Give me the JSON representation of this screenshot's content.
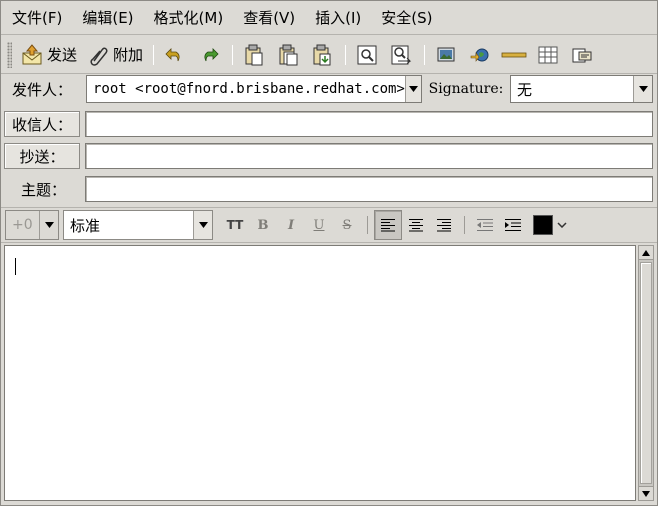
{
  "menubar": {
    "items": [
      "文件(F)",
      "编辑(E)",
      "格式化(M)",
      "查看(V)",
      "插入(I)",
      "安全(S)"
    ]
  },
  "toolbar": {
    "send_label": "发送",
    "attach_label": "附加",
    "icons": [
      "send-icon",
      "attach-icon",
      "undo-icon",
      "redo-icon",
      "cut-icon",
      "copy-icon",
      "paste-icon",
      "find-icon",
      "replace-icon",
      "insert-image-icon",
      "insert-link-icon",
      "insert-rule-icon",
      "insert-table-icon",
      "insert-html-icon"
    ]
  },
  "header": {
    "from_label": "发件人：",
    "from_value": "root <root@fnord.brisbane.redhat.com>",
    "signature_label": "Signature:",
    "signature_value": "无",
    "to_label": "收信人：",
    "to_value": "",
    "cc_label": "抄送：",
    "cc_value": "",
    "subject_label": "主题：",
    "subject_value": ""
  },
  "format_toolbar": {
    "font_size": "+0",
    "paragraph_style": "标准",
    "tt_label": "TT",
    "bold_label": "B",
    "italic_label": "I",
    "underline_label": "U",
    "strike_label": "S",
    "text_color": "#000000"
  },
  "editor": {
    "body_text": ""
  }
}
